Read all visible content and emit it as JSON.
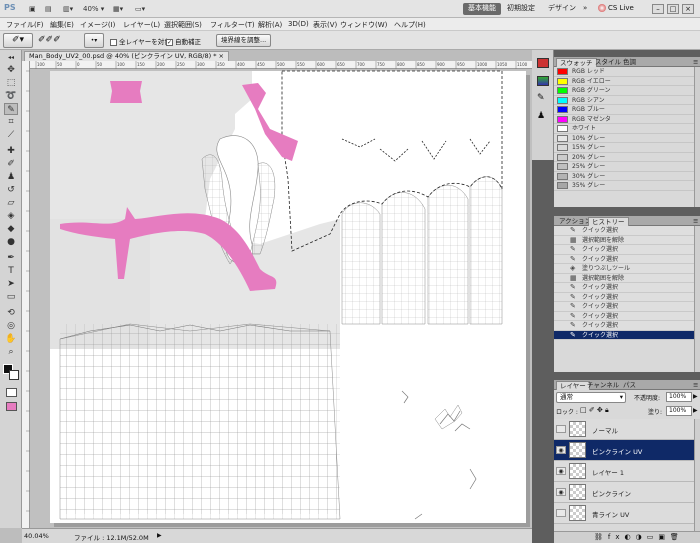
{
  "appbar": {
    "logo": "PS",
    "zoom": "40%",
    "workspaces": [
      "基本機能",
      "初期設定",
      "デザイン"
    ],
    "active_workspace": 0,
    "cslive": "CS Live"
  },
  "menu": [
    "ファイル(F)",
    "編集(E)",
    "イメージ(I)",
    "レイヤー(L)",
    "選択範囲(S)",
    "フィルター(T)",
    "解析(A)",
    "3D(D)",
    "表示(V)",
    "ウィンドウ(W)",
    "ヘルプ(H)"
  ],
  "options": {
    "all_layers_label": "全レイヤーを対象",
    "auto_enhance_label": "自動補正",
    "refine_edge_button": "境界線を調整..."
  },
  "document": {
    "tab_title": "Man_Body_UV2_00.psd @ 40% (ピンクライン UV, RGB/8) *",
    "ruler_marks": [
      "100",
      "50",
      "0",
      "50",
      "100",
      "150",
      "200",
      "250",
      "300",
      "350",
      "400",
      "450",
      "500",
      "550",
      "600",
      "650",
      "700",
      "750",
      "800",
      "850",
      "900",
      "950",
      "1000",
      "1050",
      "1100"
    ],
    "pink_color": "#e67cc0"
  },
  "status": {
    "zoom": "40.04%",
    "file_info": "ファイル : 12.1M/52.0M"
  },
  "swatches": {
    "tabs": [
      "スウォッチ",
      "スタイル",
      "色調"
    ],
    "items": [
      {
        "name": "RGB レッド",
        "color": "#ff0000"
      },
      {
        "name": "RGB イエロー",
        "color": "#ffff00"
      },
      {
        "name": "RGB グリーン",
        "color": "#00ff00"
      },
      {
        "name": "RGB シアン",
        "color": "#00ffff"
      },
      {
        "name": "RGB ブルー",
        "color": "#0000ff"
      },
      {
        "name": "RGB マゼンタ",
        "color": "#ff00ff"
      },
      {
        "name": "ホワイト",
        "color": "#ffffff"
      },
      {
        "name": "10% グレー",
        "color": "#e6e6e6"
      },
      {
        "name": "15% グレー",
        "color": "#d9d9d9"
      },
      {
        "name": "20% グレー",
        "color": "#cccccc"
      },
      {
        "name": "25% グレー",
        "color": "#bfbfbf"
      },
      {
        "name": "30% グレー",
        "color": "#b3b3b3"
      },
      {
        "name": "35% グレー",
        "color": "#a6a6a6"
      }
    ]
  },
  "history": {
    "tabs": [
      "アクション",
      "ヒストリー"
    ],
    "items": [
      {
        "icon": "quick-select",
        "label": "クイック選択"
      },
      {
        "icon": "deselect",
        "label": "選択範囲を解除"
      },
      {
        "icon": "quick-select",
        "label": "クイック選択"
      },
      {
        "icon": "quick-select",
        "label": "クイック選択"
      },
      {
        "icon": "paint-bucket",
        "label": "塗りつぶしツール"
      },
      {
        "icon": "deselect",
        "label": "選択範囲を解除"
      },
      {
        "icon": "quick-select",
        "label": "クイック選択"
      },
      {
        "icon": "quick-select",
        "label": "クイック選択"
      },
      {
        "icon": "quick-select",
        "label": "クイック選択"
      },
      {
        "icon": "quick-select",
        "label": "クイック選択"
      },
      {
        "icon": "quick-select",
        "label": "クイック選択"
      },
      {
        "icon": "quick-select",
        "label": "クイック選択"
      }
    ],
    "selected_index": 11
  },
  "layers": {
    "tabs": [
      "レイヤー",
      "チャンネル",
      "パス"
    ],
    "blend_mode": "通常",
    "opacity_label": "不透明度:",
    "opacity": "100%",
    "lock_label": "ロック :",
    "fill_label": "塗り:",
    "fill": "100%",
    "items": [
      {
        "name": "ノーマル",
        "visible": false
      },
      {
        "name": "ピンクライン UV",
        "visible": true
      },
      {
        "name": "レイヤー 1",
        "visible": true
      },
      {
        "name": "ピンクライン",
        "visible": true
      },
      {
        "name": "青ライン UV",
        "visible": false
      }
    ],
    "selected_index": 1
  }
}
